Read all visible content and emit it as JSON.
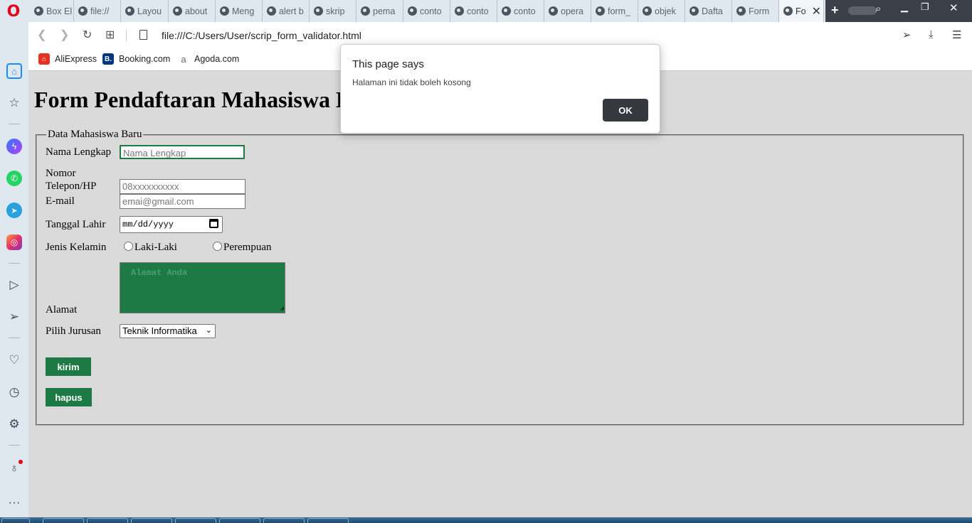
{
  "browser": {
    "tabs": [
      {
        "label": "Box El"
      },
      {
        "label": "file://"
      },
      {
        "label": "Layou"
      },
      {
        "label": "about"
      },
      {
        "label": "Meng"
      },
      {
        "label": "alert b"
      },
      {
        "label": "skrip"
      },
      {
        "label": "pema"
      },
      {
        "label": "conto"
      },
      {
        "label": "conto"
      },
      {
        "label": "conto"
      },
      {
        "label": "opera"
      },
      {
        "label": "form_"
      },
      {
        "label": "objek"
      },
      {
        "label": "Dafta"
      },
      {
        "label": "Form"
      },
      {
        "label": "Fo",
        "active": true
      }
    ],
    "url": "file:///C:/Users/User/scrip_form_validator.html",
    "bookmarks": [
      {
        "label": "AliExpress",
        "icon": "aliexpress-icon"
      },
      {
        "label": "Booking.com",
        "icon": "booking-icon",
        "glyph": "B."
      },
      {
        "label": "Agoda.com",
        "icon": "agoda-icon",
        "glyph": "a"
      }
    ],
    "accent_color": "#1a8cff",
    "brand_color": "#e6001c"
  },
  "page": {
    "title": "Form Pendaftaran Mahasiswa B",
    "fieldset_legend": "Data Mahasiswa Baru",
    "fields": {
      "nama": {
        "label": "Nama Lengkap",
        "placeholder": "Nama Lengkap"
      },
      "telepon": {
        "label_line1": "Nomor",
        "label_line2": "Telepon/HP",
        "placeholder": "08xxxxxxxxxx"
      },
      "email": {
        "label": "E-mail",
        "placeholder": "emai@gmail.com"
      },
      "tanggal": {
        "label": "Tanggal Lahir",
        "value": "mm/dd/yyyy"
      },
      "kelamin": {
        "label": "Jenis Kelamin",
        "options": [
          "Laki-Laki",
          "Perempuan"
        ]
      },
      "alamat": {
        "label": "Alamat",
        "placeholder": "Alamat Anda"
      },
      "jurusan": {
        "label": "Pilih Jurusan",
        "selected": "Teknik Informatika"
      }
    },
    "buttons": {
      "submit": "kirim",
      "reset": "hapus"
    },
    "theme_color": "#1e7a45"
  },
  "dialog": {
    "title": "This page says",
    "message": "Halaman ini tidak boleh kosong",
    "ok_label": "OK"
  }
}
